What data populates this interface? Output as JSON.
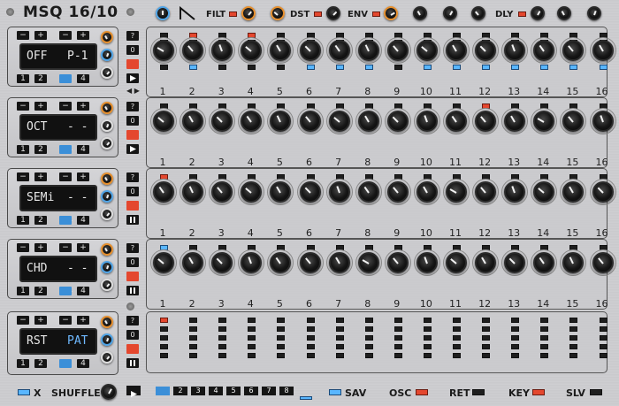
{
  "module": {
    "title": "MSQ 16/10"
  },
  "top_controls": {
    "filt_label": "FILT",
    "dst_label": "DST",
    "env_label": "ENV",
    "dly_label": "DLY",
    "wave_icon": "sawtooth-wave-icon"
  },
  "track_settings": [
    {
      "mode": "OFF",
      "value": "P-1",
      "selected": 3
    },
    {
      "mode": "OCT",
      "value": "- - -",
      "selected": 3
    },
    {
      "mode": "SEMi",
      "value": "- - -",
      "selected": 3
    },
    {
      "mode": "CHD",
      "value": "- - -",
      "selected": 3
    },
    {
      "mode": "RST",
      "value": "PAT",
      "selected": 3
    }
  ],
  "settings_buttons": {
    "minus": "−",
    "plus": "+",
    "slots": [
      "1",
      "2",
      "3",
      "4"
    ]
  },
  "side_buttons": {
    "help": "?",
    "zero": "0"
  },
  "step_numbers": [
    "1",
    "2",
    "3",
    "4",
    "5",
    "6",
    "7",
    "8",
    "9",
    "10",
    "11",
    "12",
    "13",
    "14",
    "15",
    "16"
  ],
  "bottom_bar": {
    "x_label": "X",
    "shuffle_label": "SHUFFLE",
    "pattern_buttons": [
      "1",
      "2",
      "3",
      "4",
      "5",
      "6",
      "7",
      "8"
    ],
    "selected_pattern": 1,
    "sav_label": "SAV",
    "osc_label": "OSC",
    "ret_label": "RET",
    "key_label": "KEY",
    "slv_label": "SLV"
  },
  "colors": {
    "accent_red": "#e4472e",
    "accent_blue": "#59b6ff",
    "knob_orange": "#e58f2e"
  }
}
